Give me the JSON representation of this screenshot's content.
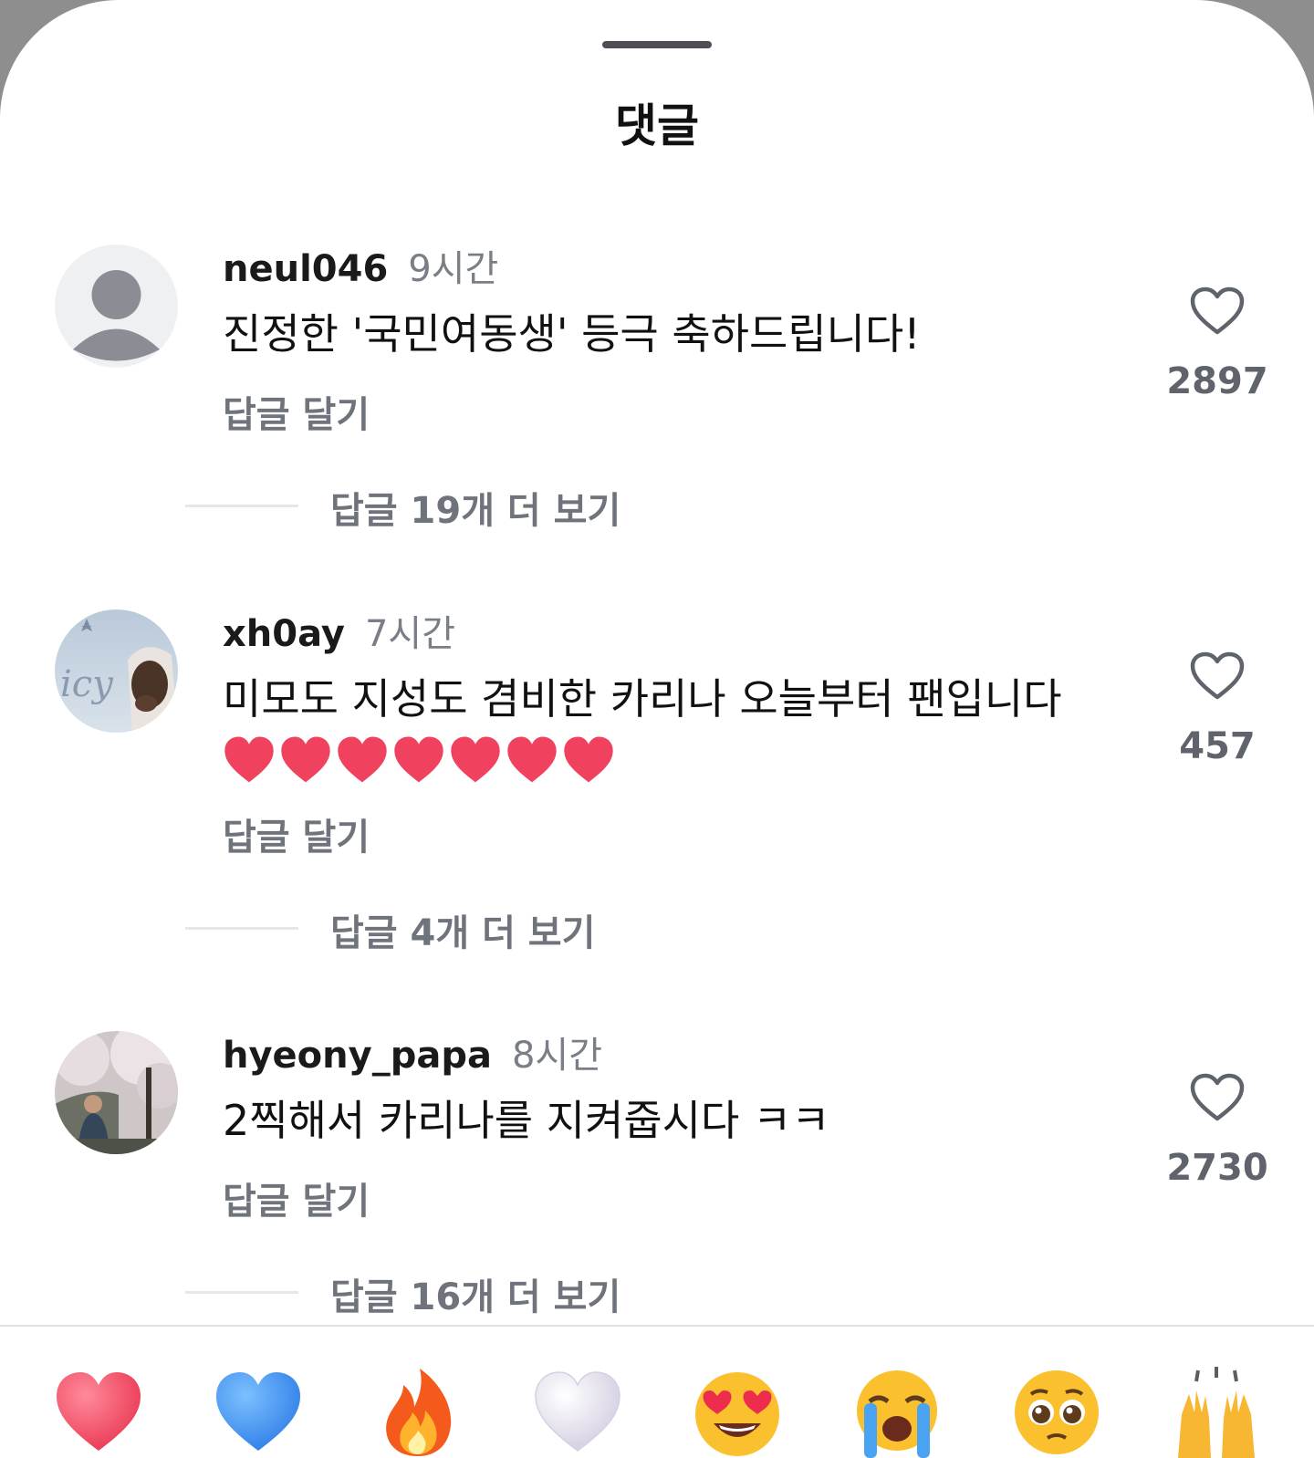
{
  "header": {
    "title": "댓글"
  },
  "comments": [
    {
      "username": "neul046",
      "time": "9시간",
      "text": "진정한 '국민여동생' 등극 축하드립니다!",
      "reply_label": "답글 달기",
      "likes": "2897",
      "more_replies": "답글 19개 더 보기",
      "avatar_icon": "default-user-icon"
    },
    {
      "username": "xh0ay",
      "time": "7시간",
      "text": "미모도 지성도 겸비한 카리나 오늘부터 팬입니다",
      "heart_emoji_count": 7,
      "heart_emoji": "red-heart",
      "reply_label": "답글 달기",
      "likes": "457",
      "more_replies": "답글 4개 더 보기",
      "avatar_icon": "user-photo"
    },
    {
      "username": "hyeony_papa",
      "time": "8시간",
      "text": "2찍해서 카리나를 지켜줍시다 ㅋㅋ",
      "reply_label": "답글 달기",
      "likes": "2730",
      "more_replies": "답글 16개 더 보기",
      "avatar_icon": "user-photo"
    }
  ],
  "emoji_bar": [
    "red-heart-emoji",
    "blue-heart-emoji",
    "fire-emoji",
    "white-heart-emoji",
    "heart-eyes-emoji",
    "loudly-crying-emoji",
    "pleading-face-emoji",
    "raising-hands-emoji"
  ],
  "colors": {
    "text_primary": "#111111",
    "text_secondary": "#7a7f87",
    "heart_red": "#f0415f",
    "heart_blue": "#3c8df0"
  }
}
